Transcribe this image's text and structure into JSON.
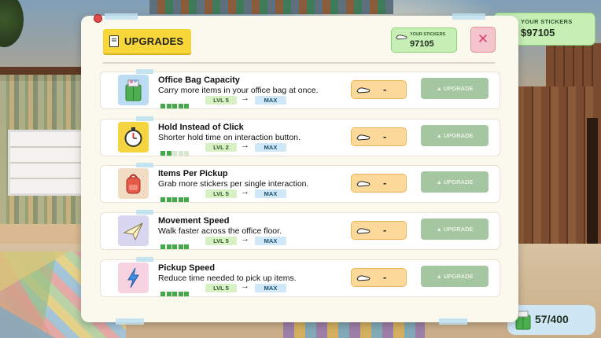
{
  "hud": {
    "stickers_label": "YOUR STICKERS",
    "stickers_value": "$97105",
    "bag_value": "57/400"
  },
  "panel": {
    "title": "UPGRADES",
    "stickers_label": "YOUR STICKERS",
    "stickers_value": "97105",
    "close_label": "✕"
  },
  "upgrades": [
    {
      "name": "Office Bag Capacity",
      "description": "Carry more items in your office bag at once.",
      "level": "LVL 5",
      "next": "MAX",
      "progress": 5,
      "max_progress": 5,
      "cost": "-",
      "button": "▲ UPGRADE",
      "icon": "green-bag-icon",
      "icon_bg": "#bcdcf3"
    },
    {
      "name": "Hold Instead of Click",
      "description": "Shorter hold time on interaction button.",
      "level": "LVL 2",
      "next": "MAX",
      "progress": 2,
      "max_progress": 5,
      "cost": "-",
      "button": "▲ UPGRADE",
      "icon": "stopwatch-icon",
      "icon_bg": "#f5d53f"
    },
    {
      "name": "Items Per Pickup",
      "description": "Grab more stickers per single interaction.",
      "level": "LVL 5",
      "next": "MAX",
      "progress": 5,
      "max_progress": 5,
      "cost": "-",
      "button": "▲ UPGRADE",
      "icon": "backpack-icon",
      "icon_bg": "#f2dcc4"
    },
    {
      "name": "Movement Speed",
      "description": "Walk faster across the office floor.",
      "level": "LVL 5",
      "next": "MAX",
      "progress": 5,
      "max_progress": 5,
      "cost": "-",
      "button": "▲ UPGRADE",
      "icon": "paper-plane-icon",
      "icon_bg": "#d9d6f1"
    },
    {
      "name": "Pickup Speed",
      "description": "Reduce time needed to pick up items.",
      "level": "LVL 5",
      "next": "MAX",
      "progress": 5,
      "max_progress": 5,
      "cost": "-",
      "button": "▲ UPGRADE",
      "icon": "lightning-icon",
      "icon_bg": "#f7d3e1"
    }
  ],
  "colors": {
    "accent_yellow": "#f7d63a",
    "sticker_green": "#c7efb5",
    "cost_orange": "#fcd99a",
    "upgrade_disabled": "#a4c6a0",
    "pip_green": "#45a84a",
    "close_pink": "#f4c5cc"
  }
}
